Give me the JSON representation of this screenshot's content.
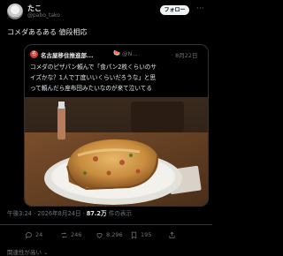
{
  "post": {
    "author_name": "たこ",
    "author_handle": "@pabo_tako",
    "follow_label": "フォロー",
    "more_label": "···",
    "text": "コメダあるある 値段相応"
  },
  "quote": {
    "avatar_text": "名",
    "name": "名古屋移住推進部...",
    "emoji": "🍉",
    "handle": "@N...",
    "date": "· 8月22日",
    "lines": [
      "コメダのピザパン頼んで「食パン2枚くらいのサ",
      "イズかな？1人で丁度いいくらいだろうな」と思",
      "って頼んだら座布団みたいなのが来て泣いてる"
    ]
  },
  "meta": {
    "time": "午後3:24 · 2026年8月24日 · ",
    "views_count": "87.2万",
    "views_label": " 件の表示"
  },
  "actions": {
    "replies": "24",
    "reposts": "246",
    "likes": "8,296",
    "bookmarks": "195"
  },
  "related_label": "関連性が高い ⌄"
}
